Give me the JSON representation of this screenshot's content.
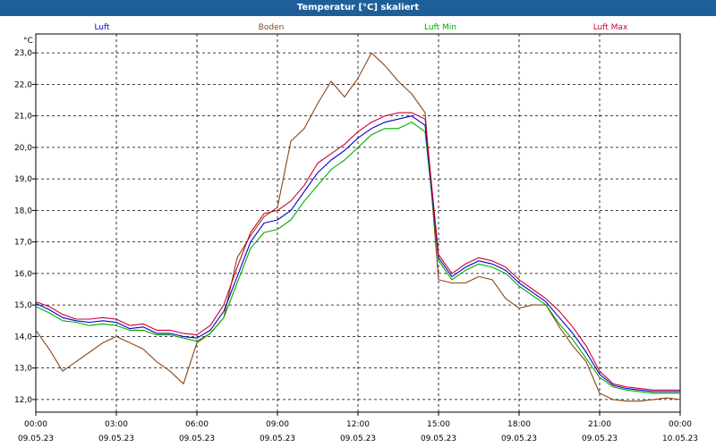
{
  "window": {
    "title": "Temperatur [°C] skaliert"
  },
  "chart_data": {
    "type": "line",
    "title": "Temperatur [°C] skaliert",
    "ylabel": "°C",
    "xlabel": "",
    "ylim": [
      11.6,
      23.6
    ],
    "xlim": [
      0,
      24
    ],
    "grid": true,
    "y_ticks": [
      "12,0",
      "13,0",
      "14,0",
      "15,0",
      "16,0",
      "17,0",
      "18,0",
      "19,0",
      "20,0",
      "21,0",
      "22,0",
      "23,0"
    ],
    "x_ticks": [
      {
        "time": "00:00",
        "date": "09.05.23"
      },
      {
        "time": "03:00",
        "date": "09.05.23"
      },
      {
        "time": "06:00",
        "date": "09.05.23"
      },
      {
        "time": "09:00",
        "date": "09.05.23"
      },
      {
        "time": "12:00",
        "date": "09.05.23"
      },
      {
        "time": "15:00",
        "date": "09.05.23"
      },
      {
        "time": "18:00",
        "date": "09.05.23"
      },
      {
        "time": "21:00",
        "date": "09.05.23"
      },
      {
        "time": "00:00",
        "date": "10.05.23"
      }
    ],
    "x_hours": [
      0,
      0.5,
      1,
      1.5,
      2,
      2.5,
      3,
      3.5,
      4,
      4.5,
      5,
      5.5,
      6,
      6.5,
      7,
      7.5,
      8,
      8.5,
      9,
      9.5,
      10,
      10.5,
      11,
      11.5,
      12,
      12.5,
      13,
      13.5,
      14,
      14.5,
      15,
      15.5,
      16,
      16.5,
      17,
      17.5,
      18,
      18.5,
      19,
      19.5,
      20,
      20.5,
      21,
      21.5,
      22,
      22.5,
      23,
      23.5,
      24
    ],
    "series": [
      {
        "name": "Luft",
        "color": "#0000cc",
        "values": [
          15.05,
          14.85,
          14.6,
          14.5,
          14.45,
          14.5,
          14.45,
          14.25,
          14.3,
          14.1,
          14.1,
          14.0,
          13.95,
          14.2,
          14.8,
          15.9,
          17.0,
          17.6,
          17.7,
          18.0,
          18.6,
          19.2,
          19.6,
          19.9,
          20.3,
          20.6,
          20.8,
          20.9,
          21.0,
          20.7,
          16.5,
          15.9,
          16.2,
          16.4,
          16.3,
          16.1,
          15.7,
          15.4,
          15.1,
          14.6,
          14.1,
          13.5,
          12.8,
          12.45,
          12.35,
          12.3,
          12.25,
          12.25,
          12.25
        ]
      },
      {
        "name": "Boden",
        "color": "#8b4513",
        "values": [
          14.2,
          13.6,
          12.9,
          13.2,
          13.5,
          13.8,
          14.0,
          13.8,
          13.6,
          13.2,
          12.9,
          12.5,
          13.8,
          14.1,
          14.6,
          16.5,
          17.2,
          17.8,
          18.1,
          20.2,
          20.6,
          21.4,
          22.1,
          21.6,
          22.2,
          23.0,
          22.6,
          22.1,
          21.7,
          21.1,
          15.8,
          15.7,
          15.7,
          15.9,
          15.8,
          15.2,
          14.9,
          15.0,
          15.0,
          14.3,
          13.7,
          13.2,
          12.2,
          12.0,
          11.95,
          11.95,
          12.0,
          12.05,
          12.0
        ]
      },
      {
        "name": "Luft Min",
        "color": "#00aa00",
        "values": [
          14.95,
          14.75,
          14.5,
          14.45,
          14.35,
          14.4,
          14.35,
          14.2,
          14.2,
          14.05,
          14.05,
          13.95,
          13.85,
          14.1,
          14.6,
          15.7,
          16.8,
          17.3,
          17.4,
          17.7,
          18.3,
          18.8,
          19.3,
          19.6,
          20.0,
          20.4,
          20.6,
          20.6,
          20.8,
          20.5,
          16.4,
          15.8,
          16.1,
          16.3,
          16.2,
          16.0,
          15.6,
          15.3,
          15.0,
          14.4,
          13.9,
          13.3,
          12.7,
          12.4,
          12.3,
          12.25,
          12.2,
          12.2,
          12.2
        ]
      },
      {
        "name": "Luft Max",
        "color": "#cc0033",
        "values": [
          15.1,
          14.95,
          14.7,
          14.55,
          14.55,
          14.6,
          14.55,
          14.35,
          14.4,
          14.2,
          14.2,
          14.1,
          14.05,
          14.35,
          15.0,
          16.2,
          17.3,
          17.9,
          18.0,
          18.3,
          18.8,
          19.5,
          19.8,
          20.1,
          20.5,
          20.8,
          21.0,
          21.1,
          21.1,
          20.9,
          16.6,
          16.0,
          16.3,
          16.5,
          16.4,
          16.2,
          15.8,
          15.5,
          15.2,
          14.8,
          14.3,
          13.7,
          12.9,
          12.5,
          12.4,
          12.35,
          12.3,
          12.3,
          12.3
        ]
      }
    ]
  }
}
